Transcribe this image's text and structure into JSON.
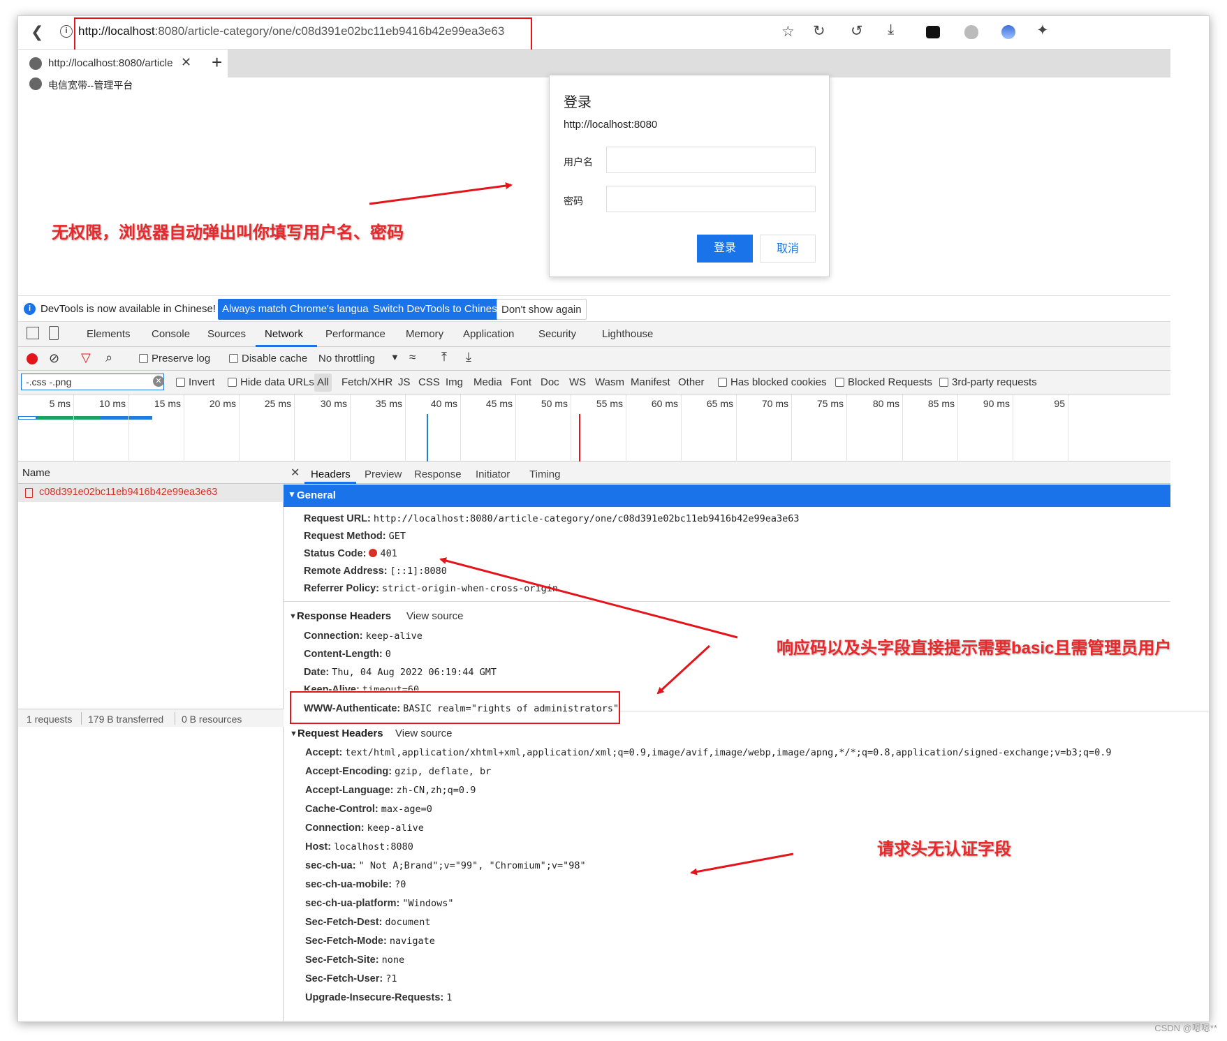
{
  "browser": {
    "url_host": "http://localhost",
    "url_rest": ":8080/article-category/one/c08d391e02bc11eb9416b42e99ea3e63",
    "tab_title": "http://localhost:8080/article",
    "page_title": "电信宽带--管理平台"
  },
  "login_dialog": {
    "title": "登录",
    "origin": "http://localhost:8080",
    "username_label": "用户名",
    "password_label": "密码",
    "login_button": "登录",
    "cancel_button": "取消"
  },
  "annotations": {
    "no_permission": "无权限，浏览器自动弹出叫你填写用户名、密码",
    "response_hint": "响应码以及头字段直接提示需要basic且需管理员用户",
    "request_hint": "请求头无认证字段"
  },
  "devtools_banner": {
    "message": "DevTools is now available in Chinese!",
    "btn_match": "Always match Chrome's language",
    "btn_switch": "Switch DevTools to Chinese",
    "btn_dont": "Don't show again"
  },
  "devtools_tabs": [
    "Elements",
    "Console",
    "Sources",
    "Network",
    "Performance",
    "Memory",
    "Application",
    "Security",
    "Lighthouse"
  ],
  "network_toolbar": {
    "preserve_log": "Preserve log",
    "disable_cache": "Disable cache",
    "throttling": "No throttling"
  },
  "filter_bar": {
    "filter_value": "-.css -.png",
    "invert": "Invert",
    "hide_data_urls": "Hide data URLs",
    "types": [
      "All",
      "Fetch/XHR",
      "JS",
      "CSS",
      "Img",
      "Media",
      "Font",
      "Doc",
      "WS",
      "Wasm",
      "Manifest",
      "Other"
    ],
    "has_blocked_cookies": "Has blocked cookies",
    "blocked_requests": "Blocked Requests",
    "third_party": "3rd-party requests"
  },
  "timeline_ticks": [
    "5 ms",
    "10 ms",
    "15 ms",
    "20 ms",
    "25 ms",
    "30 ms",
    "35 ms",
    "40 ms",
    "45 ms",
    "50 ms",
    "55 ms",
    "60 ms",
    "65 ms",
    "70 ms",
    "75 ms",
    "80 ms",
    "85 ms",
    "90 ms",
    "95"
  ],
  "requests": {
    "column_name": "Name",
    "items": [
      "c08d391e02bc11eb9416b42e99ea3e63"
    ],
    "summary_requests": "1 requests",
    "summary_transferred": "179 B transferred",
    "summary_resources": "0 B resources"
  },
  "detail_tabs": [
    "Headers",
    "Preview",
    "Response",
    "Initiator",
    "Timing"
  ],
  "general": {
    "section": "General",
    "rows": [
      {
        "key": "Request URL:",
        "value": "http://localhost:8080/article-category/one/c08d391e02bc11eb9416b42e99ea3e63"
      },
      {
        "key": "Request Method:",
        "value": "GET"
      },
      {
        "key": "Status Code:",
        "value": "401"
      },
      {
        "key": "Remote Address:",
        "value": "[::1]:8080"
      },
      {
        "key": "Referrer Policy:",
        "value": "strict-origin-when-cross-origin"
      }
    ]
  },
  "response_headers": {
    "section": "Response Headers",
    "view_source": "View source",
    "rows": [
      {
        "key": "Connection:",
        "value": "keep-alive"
      },
      {
        "key": "Content-Length:",
        "value": "0"
      },
      {
        "key": "Date:",
        "value": "Thu, 04 Aug 2022 06:19:44 GMT"
      },
      {
        "key": "Keep-Alive:",
        "value": "timeout=60"
      },
      {
        "key": "WWW-Authenticate:",
        "value": "BASIC realm=\"rights of administrators\""
      }
    ]
  },
  "request_headers": {
    "section": "Request Headers",
    "view_source": "View source",
    "rows": [
      {
        "key": "Accept:",
        "value": "text/html,application/xhtml+xml,application/xml;q=0.9,image/avif,image/webp,image/apng,*/*;q=0.8,application/signed-exchange;v=b3;q=0.9"
      },
      {
        "key": "Accept-Encoding:",
        "value": "gzip, deflate, br"
      },
      {
        "key": "Accept-Language:",
        "value": "zh-CN,zh;q=0.9"
      },
      {
        "key": "Cache-Control:",
        "value": "max-age=0"
      },
      {
        "key": "Connection:",
        "value": "keep-alive"
      },
      {
        "key": "Host:",
        "value": "localhost:8080"
      },
      {
        "key": "sec-ch-ua:",
        "value": "\" Not A;Brand\";v=\"99\", \"Chromium\";v=\"98\""
      },
      {
        "key": "sec-ch-ua-mobile:",
        "value": "?0"
      },
      {
        "key": "sec-ch-ua-platform:",
        "value": "\"Windows\""
      },
      {
        "key": "Sec-Fetch-Dest:",
        "value": "document"
      },
      {
        "key": "Sec-Fetch-Mode:",
        "value": "navigate"
      },
      {
        "key": "Sec-Fetch-Site:",
        "value": "none"
      },
      {
        "key": "Sec-Fetch-User:",
        "value": "?1"
      },
      {
        "key": "Upgrade-Insecure-Requests:",
        "value": "1"
      }
    ]
  },
  "watermark": "CSDN @嗯嗯**",
  "colors": {
    "accent": "#1a73e8",
    "annotation": "#e8282a",
    "error": "#d93025"
  }
}
